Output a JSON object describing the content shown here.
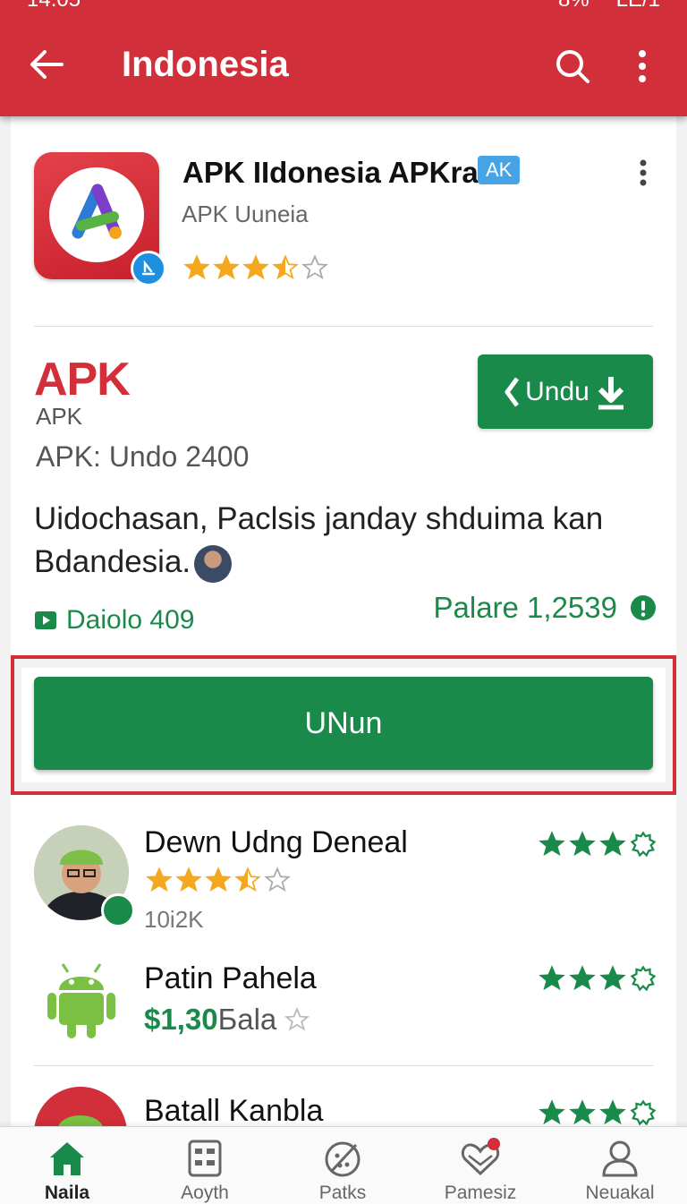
{
  "status_bar": {
    "time": "14:05",
    "battery": "8%",
    "extra": "LE/1"
  },
  "appbar": {
    "title": "Indonesia"
  },
  "app": {
    "name": "APK IIdonesia APKra",
    "badge": "AK",
    "subtitle": "APK Uuneia",
    "rating": 3.5
  },
  "detail": {
    "logo_text": "APK",
    "logo_caption": "APK",
    "version": "APK: Undo 2400",
    "undu_label": "Undu",
    "description": "Uidochasan, Paclsis janday shduima kan Bdandesia.",
    "downloads": "Daiolo 409",
    "palare": "Palare 1,2539"
  },
  "primary_button": {
    "label": "UNun"
  },
  "list": [
    {
      "title": "Dewn Udng Deneal",
      "rating": 3.5,
      "sub": "10i2K",
      "right_rating": 3
    },
    {
      "title": "Patin Pahela",
      "price": "$1,30",
      "price_suffix": "Бala",
      "right_rating": 3
    },
    {
      "title": "Batall Kanbla",
      "right_rating": 3
    }
  ],
  "nav": [
    {
      "label": "Naila",
      "icon": "home-icon",
      "active": true
    },
    {
      "label": "Aoyth",
      "icon": "apps-grid-icon",
      "active": false
    },
    {
      "label": "Patks",
      "icon": "ball-icon",
      "active": false
    },
    {
      "label": "Pamesiz",
      "icon": "heart-mail-icon",
      "active": false
    },
    {
      "label": "Neuakal",
      "icon": "profile-icon",
      "active": false
    }
  ],
  "colors": {
    "brand_red": "#d12f3a",
    "green": "#1a8a4a",
    "star": "#f3a81f"
  }
}
